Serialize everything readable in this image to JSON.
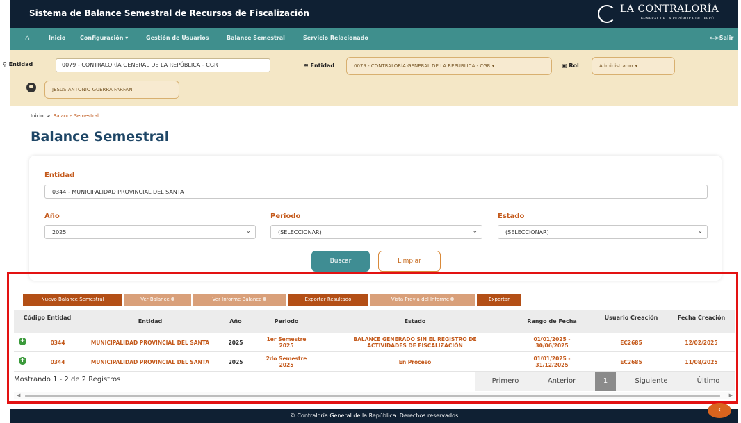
{
  "header": {
    "app_title": "Sistema de Balance Semestral de Recursos de Fiscalización",
    "brand_name": "LA CONTRALORÍA",
    "brand_sub": "GENERAL DE LA REPÚBLICA DEL PERÚ"
  },
  "nav": {
    "items": [
      "Inicio",
      "Configuración",
      "Gestión de Usuarios",
      "Balance Semestral",
      "Servicio Relacionado"
    ],
    "logout": "->Salir"
  },
  "filterbar": {
    "entidad_label": "Entidad",
    "entidad_value": "0079 - CONTRALORÍA GENERAL DE LA REPÚBLICA - CGR",
    "entidad2_label": "Entidad",
    "entidad2_value": "0079 - CONTRALORÍA GENERAL DE LA REPÚBLICA - CGR",
    "rol_label": "Rol",
    "rol_value": "Administrador",
    "user_name": "JESUS ANTONIO GUERRA FARFAN"
  },
  "breadcrumb": {
    "home": "Inicio",
    "sep": ">",
    "current": "Balance Semestral"
  },
  "page_title": "Balance Semestral",
  "form": {
    "entidad_label": "Entidad",
    "entidad_value": "0344 - MUNICIPALIDAD PROVINCIAL DEL SANTA",
    "anio_label": "Año",
    "anio_value": "2025",
    "periodo_label": "Periodo",
    "periodo_value": "(SELECCIONAR)",
    "estado_label": "Estado",
    "estado_value": "(SELECCIONAR)",
    "buscar": "Buscar",
    "limpiar": "Limpiar"
  },
  "toolbar": {
    "nuevo": "Nuevo Balance Semestral",
    "ver_balance": "Ver Balance",
    "ver_informe": "Ver Informe Balance",
    "exportar_resultado": "Exportar Resultado",
    "vista_previa": "Vista Previa del Informe",
    "exportar": "Exportar"
  },
  "table": {
    "headers": {
      "codigo": "Código Entidad",
      "entidad": "Entidad",
      "anio": "Año",
      "periodo": "Periodo",
      "estado": "Estado",
      "rango": "Rango de Fecha",
      "usuario": "Usuario Creación",
      "fecha": "Fecha Creación"
    },
    "rows": [
      {
        "codigo": "0344",
        "entidad": "MUNICIPALIDAD PROVINCIAL DEL SANTA",
        "anio": "2025",
        "periodo": "1er Semestre 2025",
        "estado": "BALANCE GENERADO SIN EL REGISTRO DE ACTIVIDADES DE FISCALIZACIÓN",
        "rango": "01/01/2025 - 30/06/2025",
        "usuario": "EC2685",
        "fecha": "12/02/2025"
      },
      {
        "codigo": "0344",
        "entidad": "MUNICIPALIDAD PROVINCIAL DEL SANTA",
        "anio": "2025",
        "periodo": "2do Semestre 2025",
        "estado": "En Proceso",
        "rango": "01/01/2025 - 31/12/2025",
        "usuario": "EC2685",
        "fecha": "11/08/2025"
      }
    ]
  },
  "pagination": {
    "summary": "Mostrando 1 - 2 de 2 Registros",
    "first": "Primero",
    "prev": "Anterior",
    "page": "1",
    "next": "Siguiente",
    "last": "Último"
  },
  "footer": {
    "copyright": "© Contraloría General de la República. Derechos reservados"
  },
  "colors": {
    "header_bg": "#0f2033",
    "nav_bg": "#3f8f8d",
    "filter_bg": "#f4e7c6",
    "accent_orange": "#c45a1c",
    "title_blue": "#1e4666",
    "highlight_red": "#e31212"
  },
  "icons": [
    "home-icon",
    "search-icon",
    "database-icon",
    "id-card-icon",
    "user-circle-icon",
    "chevron-down-icon",
    "plus-circle-icon",
    "logout-icon",
    "chat-icon"
  ]
}
